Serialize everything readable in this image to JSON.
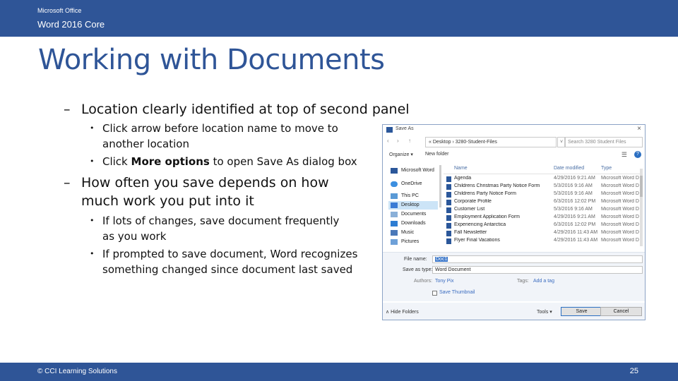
{
  "header": {
    "brand": "Microsoft Office",
    "course": "Word 2016 Core"
  },
  "title": "Working with Documents",
  "bullets": {
    "b1": "Location clearly identified at top of second panel",
    "b1a_line1": "Click arrow before location name to move to",
    "b1a_line2": "another location",
    "b1b_pre": "Click ",
    "b1b_bold": "More options",
    "b1b_post": " to open Save As dialog box",
    "b2_line1": "How often you save depends on how",
    "b2_line2": "much work you put into it",
    "b2a_line1": "If lots of changes, save document frequently",
    "b2a_line2": "as you work",
    "b2b_line1": "If prompted to save document, Word recognizes",
    "b2b_line2": "something changed since document last saved",
    "dash": "–",
    "dot": "•"
  },
  "dialog": {
    "title": "Save As",
    "close": "×",
    "nav_back": "‹",
    "nav_fwd": "›",
    "nav_up": "↑",
    "path": "« Desktop › 3280-Student-Files",
    "path_drop": "˅",
    "search_placeholder": "Search 3280 Student Files",
    "organize": "Organize ▾",
    "new_folder": "New folder",
    "view_icon": "☰",
    "help": "?",
    "nav_items": [
      {
        "label": "Microsoft Word"
      },
      {
        "label": "OneDrive"
      },
      {
        "label": "This PC"
      },
      {
        "label": "Desktop"
      },
      {
        "label": "Documents"
      },
      {
        "label": "Downloads"
      },
      {
        "label": "Music"
      },
      {
        "label": "Pictures"
      }
    ],
    "columns": {
      "name": "Name",
      "date": "Date modified",
      "type": "Type"
    },
    "files": [
      {
        "name": "Agenda",
        "date": "4/29/2016 9:21 AM",
        "type": "Microsoft Word D"
      },
      {
        "name": "Childrens Christmas Party Notice Form",
        "date": "5/3/2016 9:16 AM",
        "type": "Microsoft Word D"
      },
      {
        "name": "Childrens Party Notice Form",
        "date": "5/3/2016 9:16 AM",
        "type": "Microsoft Word D"
      },
      {
        "name": "Corporate Profile",
        "date": "6/3/2016 12:02 PM",
        "type": "Microsoft Word D"
      },
      {
        "name": "Customer List",
        "date": "5/3/2016 9:16 AM",
        "type": "Microsoft Word D"
      },
      {
        "name": "Employment Application Form",
        "date": "4/29/2016 9:21 AM",
        "type": "Microsoft Word D"
      },
      {
        "name": "Experiencing Antarctica",
        "date": "6/3/2016 12:02 PM",
        "type": "Microsoft Word D"
      },
      {
        "name": "Fall Newsletter",
        "date": "4/29/2016 11:43 AM",
        "type": "Microsoft Word D"
      },
      {
        "name": "Flyer Final Vacations",
        "date": "4/29/2016 11:43 AM",
        "type": "Microsoft Word D"
      }
    ],
    "file_name_label": "File name:",
    "file_name_value": "Doc1",
    "save_type_label": "Save as type:",
    "save_type_value": "Word Document",
    "authors_label": "Authors:",
    "authors_value": "Tony Pix",
    "tags_label": "Tags:",
    "tags_value": "Add a tag",
    "thumbnail_label": "Save Thumbnail",
    "hide_folders": "∧ Hide Folders",
    "tools": "Tools ▾",
    "save": "Save",
    "cancel": "Cancel"
  },
  "footer": {
    "copyright": "© CCI Learning Solutions",
    "page": "25"
  },
  "colors": {
    "brand": "#2f5597",
    "accent": "#2b579a"
  }
}
